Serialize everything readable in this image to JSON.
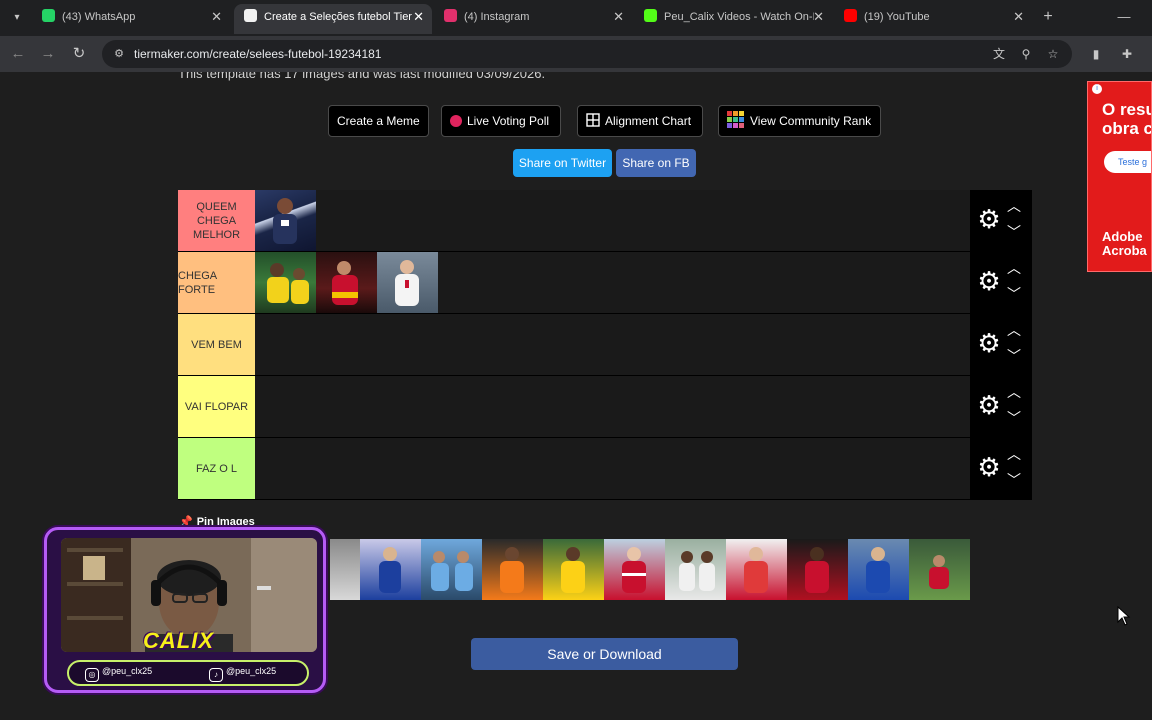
{
  "browser": {
    "tabs": [
      {
        "title": "(43) WhatsApp",
        "icon": "whatsapp-icon",
        "color": "#25d366",
        "active": false
      },
      {
        "title": "Create a Seleções futebol Tier List",
        "icon": "tiermaker-icon",
        "color": "#f2f2f2",
        "active": true
      },
      {
        "title": "(4) Instagram",
        "icon": "instagram-icon",
        "color": "#e1306c",
        "active": false
      },
      {
        "title": "Peu_Calix Videos - Watch On-Demand",
        "icon": "kick-icon",
        "color": "#53fc18",
        "active": false
      },
      {
        "title": "(19) YouTube",
        "icon": "youtube-icon",
        "color": "#ff0000",
        "active": false
      }
    ],
    "url": "tiermaker.com/create/selees-futebol-19234181"
  },
  "page": {
    "template_info": "This template has 17 images and was last modified 03/09/2026.",
    "tools": [
      {
        "label": "Create a Meme",
        "icon": ""
      },
      {
        "label": "Live Voting Poll",
        "icon": "red-dot-icon"
      },
      {
        "label": "Alignment Chart",
        "icon": "grid-icon"
      },
      {
        "label": "View Community Rank",
        "icon": "mosaic-icon"
      }
    ],
    "share": {
      "twitter": "Share on Twitter",
      "fb": "Share on FB"
    },
    "tiers": [
      {
        "label": "QUEEM CHEGA MELHOR",
        "color": "#ff7f7f",
        "items": 1
      },
      {
        "label": "CHEGA FORTE",
        "color": "#ffbf7f",
        "items": 3
      },
      {
        "label": "VEM BEM",
        "color": "#ffdf7f",
        "items": 0
      },
      {
        "label": "VAI FLOPAR",
        "color": "#ffff7f",
        "items": 0
      },
      {
        "label": "FAZ O L",
        "color": "#bfff7f",
        "items": 0
      }
    ],
    "pin_images": "Pin Images",
    "save_button": "Save or Download"
  },
  "ad": {
    "headline": "O resu obra c",
    "cta": "Teste g",
    "brand": "Adobe Acroba"
  },
  "webcam": {
    "name": "CALIX",
    "instagram": "@peu_clx25",
    "tiktok": "@peu_clx25"
  }
}
